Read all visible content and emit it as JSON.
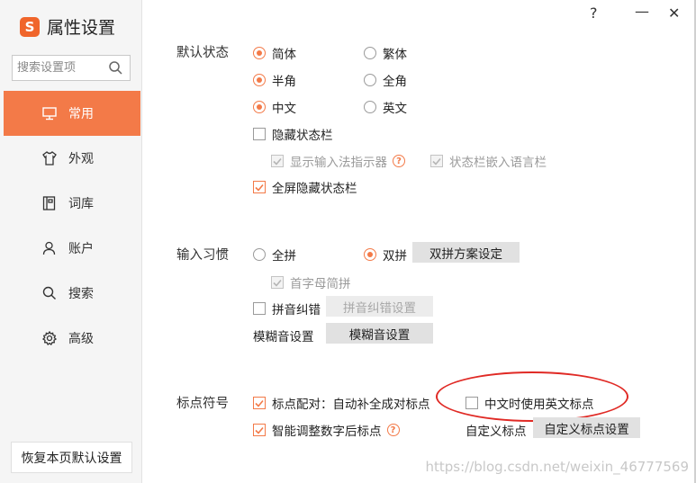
{
  "app": {
    "logo_char": "S",
    "title": "属性设置"
  },
  "search": {
    "placeholder": "搜索设置项"
  },
  "sidebar": {
    "items": [
      {
        "label": "常用",
        "icon": "monitor-icon",
        "active": true
      },
      {
        "label": "外观",
        "icon": "shirt-icon",
        "active": false
      },
      {
        "label": "词库",
        "icon": "book-icon",
        "active": false
      },
      {
        "label": "账户",
        "icon": "user-icon",
        "active": false
      },
      {
        "label": "搜索",
        "icon": "search-icon",
        "active": false
      },
      {
        "label": "高级",
        "icon": "gear-icon",
        "active": false
      }
    ],
    "restore_label": "恢复本页默认设置"
  },
  "window": {
    "help": "?",
    "minimize": "—",
    "close": "✕"
  },
  "default_state": {
    "label": "默认状态",
    "simplified": "简体",
    "traditional": "繁体",
    "half_width": "半角",
    "full_width": "全角",
    "chinese": "中文",
    "english": "英文",
    "hide_status_bar": "隐藏状态栏",
    "show_ime_indicator": "显示输入法指示器",
    "statusbar_embed_lang": "状态栏嵌入语言栏",
    "fullscreen_hide_status": "全屏隐藏状态栏"
  },
  "input_habit": {
    "label": "输入习惯",
    "full_pinyin": "全拼",
    "double_pinyin": "双拼",
    "double_pinyin_settings": "双拼方案设定",
    "initial_abbrev": "首字母简拼",
    "pinyin_correction": "拼音纠错",
    "pinyin_correction_settings": "拼音纠错设置",
    "fuzzy_sound": "模糊音设置",
    "fuzzy_sound_settings": "模糊音设置"
  },
  "punctuation": {
    "label": "标点符号",
    "auto_pair": "标点配对：自动补全成对标点",
    "english_punct_in_chinese": "中文时使用英文标点",
    "smart_after_digit": "智能调整数字后标点",
    "custom_label": "自定义标点",
    "custom_settings": "自定义标点设置"
  },
  "watermark": "https://blog.csdn.net/weixin_46777569",
  "colors": {
    "accent": "#f37a48",
    "annotation": "#e02a25"
  }
}
